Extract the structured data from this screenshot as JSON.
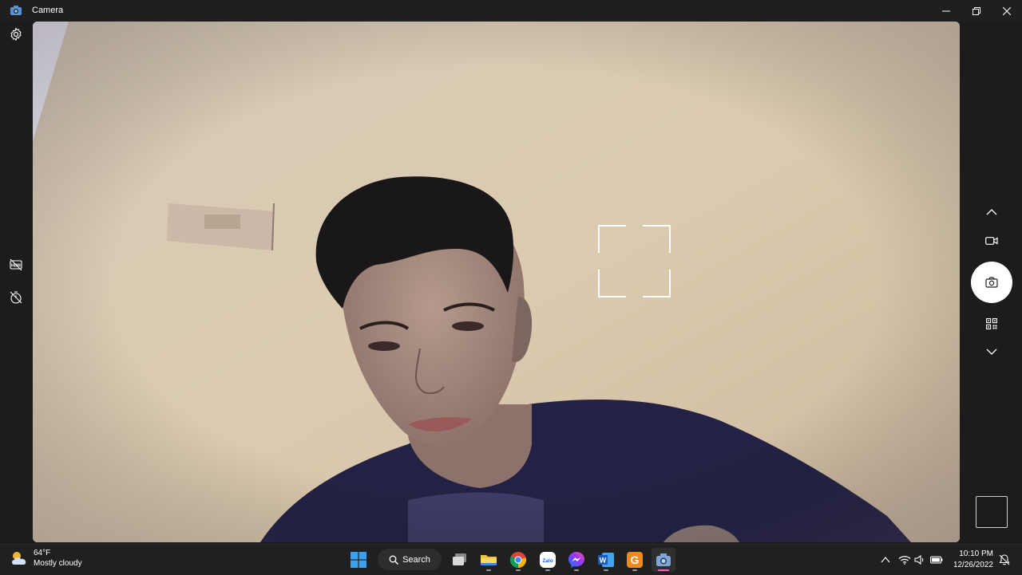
{
  "window": {
    "title": "Camera"
  },
  "left_rail": {
    "icons": [
      "gear-icon",
      "hdr-off-icon",
      "timer-off-icon"
    ]
  },
  "right_rail": {
    "icons": [
      "chevron-up-icon",
      "video-mode-icon",
      "photo-mode-icon",
      "qr-code-icon",
      "chevron-down-icon"
    ]
  },
  "taskbar": {
    "weather": {
      "temp": "64°F",
      "condition": "Mostly cloudy"
    },
    "search_label": "Search",
    "apps": [
      "windows-start-icon",
      "task-view-icon",
      "file-explorer-icon",
      "chrome-icon",
      "zalo-icon",
      "messenger-icon",
      "word-icon",
      "app-g-icon",
      "camera-icon"
    ],
    "zalo_label": "Zalo",
    "word_label": "W",
    "g_label": "G",
    "clock": {
      "time": "10:10 PM",
      "date": "12/26/2022"
    }
  },
  "colors": {
    "accent": "#ff5fc8",
    "titlebar": "#1f1f1f",
    "taskbar": "#202020"
  }
}
